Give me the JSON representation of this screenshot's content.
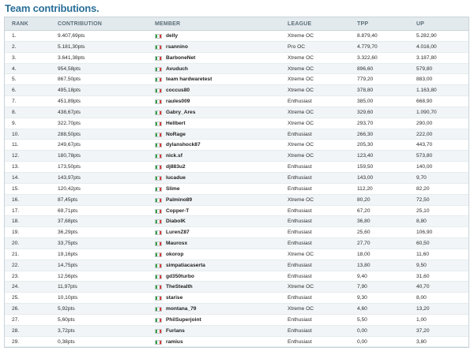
{
  "title": "Team contributions.",
  "columns": {
    "rank": "RANK",
    "contribution": "CONTRIBUTION",
    "member": "MEMBER",
    "league": "LEAGUE",
    "tpp": "TPP",
    "up": "UP"
  },
  "flag": {
    "icon": "italy-flag-icon",
    "colors": [
      "#2ea043",
      "#ffffff",
      "#d73a3a"
    ]
  },
  "rows": [
    {
      "rank": "1.",
      "contribution": "9.407,69pts",
      "member": "delly",
      "league": "Xtreme OC",
      "tpp": "8.879,40",
      "up": "5.282,90"
    },
    {
      "rank": "2.",
      "contribution": "5.181,30pts",
      "member": "rsannino",
      "league": "Pro OC",
      "tpp": "4.779,70",
      "up": "4.016,00"
    },
    {
      "rank": "3.",
      "contribution": "3.641,38pts",
      "member": "BarboneNet",
      "league": "Xtreme OC",
      "tpp": "3.322,60",
      "up": "3.187,80"
    },
    {
      "rank": "4.",
      "contribution": "954,58pts",
      "member": "Avuduch",
      "league": "Xtreme OC",
      "tpp": "896,60",
      "up": "579,80"
    },
    {
      "rank": "5.",
      "contribution": "867,50pts",
      "member": "team hardwaretest",
      "league": "Xtreme OC",
      "tpp": "779,20",
      "up": "883,00"
    },
    {
      "rank": "6.",
      "contribution": "495,18pts",
      "member": "coccus80",
      "league": "Xtreme OC",
      "tpp": "378,80",
      "up": "1.163,80"
    },
    {
      "rank": "7.",
      "contribution": "451,89pts",
      "member": "raules009",
      "league": "Enthusiast",
      "tpp": "385,00",
      "up": "668,90"
    },
    {
      "rank": "8.",
      "contribution": "438,67pts",
      "member": "Gabry_Ares",
      "league": "Xtreme OC",
      "tpp": "329,60",
      "up": "1.090,70"
    },
    {
      "rank": "9.",
      "contribution": "322,70pts",
      "member": "Hellbert",
      "league": "Xtreme OC",
      "tpp": "293,70",
      "up": "290,00"
    },
    {
      "rank": "10.",
      "contribution": "288,50pts",
      "member": "NoRage",
      "league": "Enthusiast",
      "tpp": "266,30",
      "up": "222,00"
    },
    {
      "rank": "11.",
      "contribution": "249,67pts",
      "member": "dylanshock87",
      "league": "Xtreme OC",
      "tpp": "205,30",
      "up": "443,70"
    },
    {
      "rank": "12.",
      "contribution": "180,78pts",
      "member": "nick.sf",
      "league": "Xtreme OC",
      "tpp": "123,40",
      "up": "573,80"
    },
    {
      "rank": "13.",
      "contribution": "173,50pts",
      "member": "dj883u2",
      "league": "Enthusiast",
      "tpp": "159,50",
      "up": "140,00"
    },
    {
      "rank": "14.",
      "contribution": "143,97pts",
      "member": "lucadue",
      "league": "Enthusiast",
      "tpp": "143,00",
      "up": "9,70"
    },
    {
      "rank": "15.",
      "contribution": "120,42pts",
      "member": "Slime",
      "league": "Enthusiast",
      "tpp": "112,20",
      "up": "82,20"
    },
    {
      "rank": "16.",
      "contribution": "87,45pts",
      "member": "Palmino89",
      "league": "Xtreme OC",
      "tpp": "80,20",
      "up": "72,50"
    },
    {
      "rank": "17.",
      "contribution": "69,71pts",
      "member": "Copper-T",
      "league": "Enthusiast",
      "tpp": "67,20",
      "up": "25,10"
    },
    {
      "rank": "18.",
      "contribution": "37,68pts",
      "member": "DiabolK",
      "league": "Enthusiast",
      "tpp": "36,80",
      "up": "8,80"
    },
    {
      "rank": "19.",
      "contribution": "36,29pts",
      "member": "LurenZ87",
      "league": "Enthusiast",
      "tpp": "25,60",
      "up": "106,90"
    },
    {
      "rank": "20.",
      "contribution": "33,75pts",
      "member": "Maurosx",
      "league": "Enthusiast",
      "tpp": "27,70",
      "up": "60,50"
    },
    {
      "rank": "21.",
      "contribution": "19,16pts",
      "member": "okorop",
      "league": "Xtreme OC",
      "tpp": "18,00",
      "up": "11,60"
    },
    {
      "rank": "22.",
      "contribution": "14,75pts",
      "member": "simpatiacaserta",
      "league": "Enthusiast",
      "tpp": "13,80",
      "up": "9,50"
    },
    {
      "rank": "23.",
      "contribution": "12,56pts",
      "member": "gd350turbo",
      "league": "Enthusiast",
      "tpp": "9,40",
      "up": "31,60"
    },
    {
      "rank": "24.",
      "contribution": "11,97pts",
      "member": "TheStealth",
      "league": "Xtreme OC",
      "tpp": "7,90",
      "up": "40,70"
    },
    {
      "rank": "25.",
      "contribution": "10,10pts",
      "member": "starise",
      "league": "Enthusiast",
      "tpp": "9,30",
      "up": "8,00"
    },
    {
      "rank": "26.",
      "contribution": "5,92pts",
      "member": "montana_79",
      "league": "Xtreme OC",
      "tpp": "4,60",
      "up": "13,20"
    },
    {
      "rank": "27.",
      "contribution": "5,60pts",
      "member": "PhilSuperjoint",
      "league": "Enthusiast",
      "tpp": "5,50",
      "up": "1,00"
    },
    {
      "rank": "28.",
      "contribution": "3,72pts",
      "member": "Furlans",
      "league": "Enthusiast",
      "tpp": "0,00",
      "up": "37,20"
    },
    {
      "rank": "29.",
      "contribution": "0,38pts",
      "member": "ramius",
      "league": "Enthusiast",
      "tpp": "0,00",
      "up": "3,80"
    }
  ]
}
